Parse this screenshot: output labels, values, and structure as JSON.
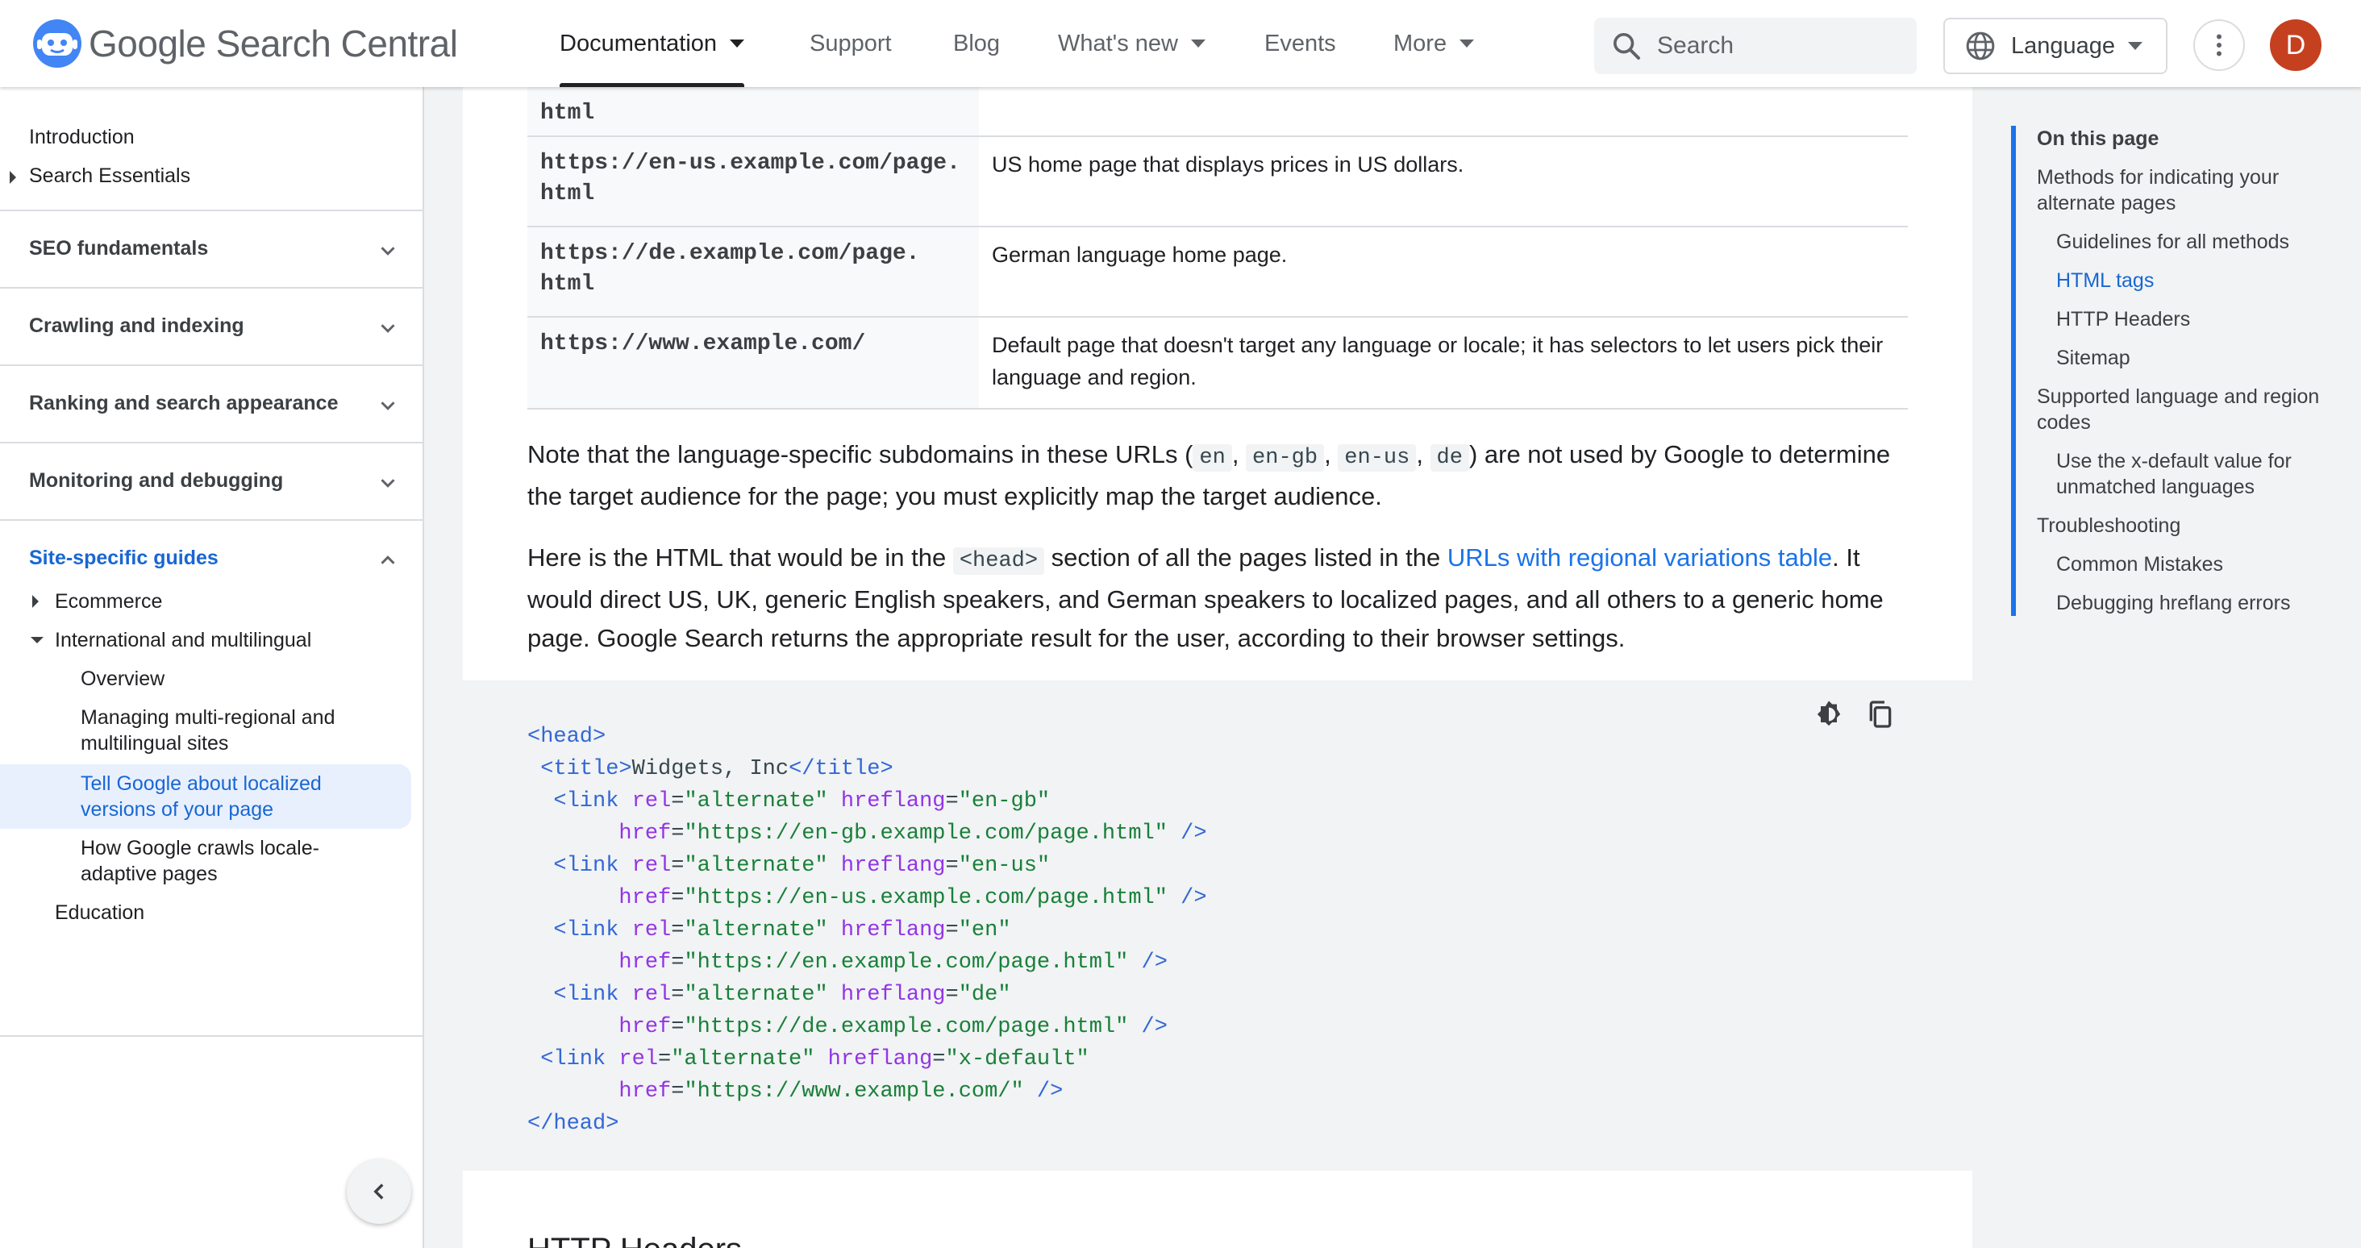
{
  "header": {
    "logo_text": "Google Search Central",
    "nav": [
      {
        "label": "Documentation",
        "active": true,
        "dropdown": true
      },
      {
        "label": "Support"
      },
      {
        "label": "Blog"
      },
      {
        "label": "What's new",
        "dropdown": true
      },
      {
        "label": "Events"
      },
      {
        "label": "More",
        "dropdown": true
      }
    ],
    "search_placeholder": "Search",
    "language_label": "Language",
    "avatar_initial": "D"
  },
  "sidebar": {
    "top_items": [
      "Introduction",
      "Search Essentials"
    ],
    "sections": [
      "SEO fundamentals",
      "Crawling and indexing",
      "Ranking and search appearance",
      "Monitoring and debugging",
      "Site-specific guides"
    ],
    "guides": {
      "ecommerce": "Ecommerce",
      "international": "International and multilingual",
      "children": [
        "Overview",
        "Managing multi-regional and multilingual sites",
        "Tell Google about localized versions of your page",
        "How Google crawls locale-adaptive pages"
      ],
      "education": "Education"
    }
  },
  "table": {
    "rows": [
      {
        "url_1": "html",
        "url_2": "",
        "desc": ""
      },
      {
        "url_1": "https://en-us.example.com/page.",
        "url_2": "html",
        "desc": "US home page that displays prices in US dollars."
      },
      {
        "url_1": "https://de.example.com/page.",
        "url_2": "html",
        "desc": "German language home page."
      },
      {
        "url_1": "https://www.example.com/",
        "url_2": "",
        "desc": "Default page that doesn't target any language or locale; it has selectors to let users pick their language and region."
      }
    ]
  },
  "para1": {
    "before": "Note that the language-specific subdomains in these URLs (",
    "codes": [
      "en",
      "en-gb",
      "en-us",
      "de"
    ],
    "after": ") are not used by Google to determine the target audience for the page; you must explicitly map the target audience."
  },
  "para2": {
    "before": "Here is the HTML that would be in the ",
    "code": "<head>",
    "middle": " section of all the pages listed in the ",
    "link": "URLs with regional variations table",
    "after": ". It would direct US, UK, generic English speakers, and German speakers to localized pages, and all others to a generic home page. Google Search returns the appropriate result for the user, according to their browser settings."
  },
  "code": {
    "title_text": "Widgets, Inc",
    "links": [
      {
        "hreflang": "en-gb",
        "href": "https://en-gb.example.com/page.html"
      },
      {
        "hreflang": "en-us",
        "href": "https://en-us.example.com/page.html"
      },
      {
        "hreflang": "en",
        "href": "https://en.example.com/page.html"
      },
      {
        "hreflang": "de",
        "href": "https://de.example.com/page.html"
      },
      {
        "hreflang": "x-default",
        "href": "https://www.example.com/"
      }
    ]
  },
  "next_heading": "HTTP Headers",
  "toc": {
    "title": "On this page",
    "items": [
      {
        "label": "Methods for indicating your alternate pages",
        "level": 1
      },
      {
        "label": "Guidelines for all methods",
        "level": 2
      },
      {
        "label": "HTML tags",
        "level": 2,
        "active": true
      },
      {
        "label": "HTTP Headers",
        "level": 2
      },
      {
        "label": "Sitemap",
        "level": 2
      },
      {
        "label": "Supported language and region codes",
        "level": 1
      },
      {
        "label": "Use the x-default value for unmatched languages",
        "level": 2
      },
      {
        "label": "Troubleshooting",
        "level": 1
      },
      {
        "label": "Common Mistakes",
        "level": 2
      },
      {
        "label": "Debugging hreflang errors",
        "level": 2
      }
    ]
  },
  "colors": {
    "accent": "#1a73e8",
    "active_bg": "#e8f0fe",
    "avatar": "#c5401f"
  }
}
